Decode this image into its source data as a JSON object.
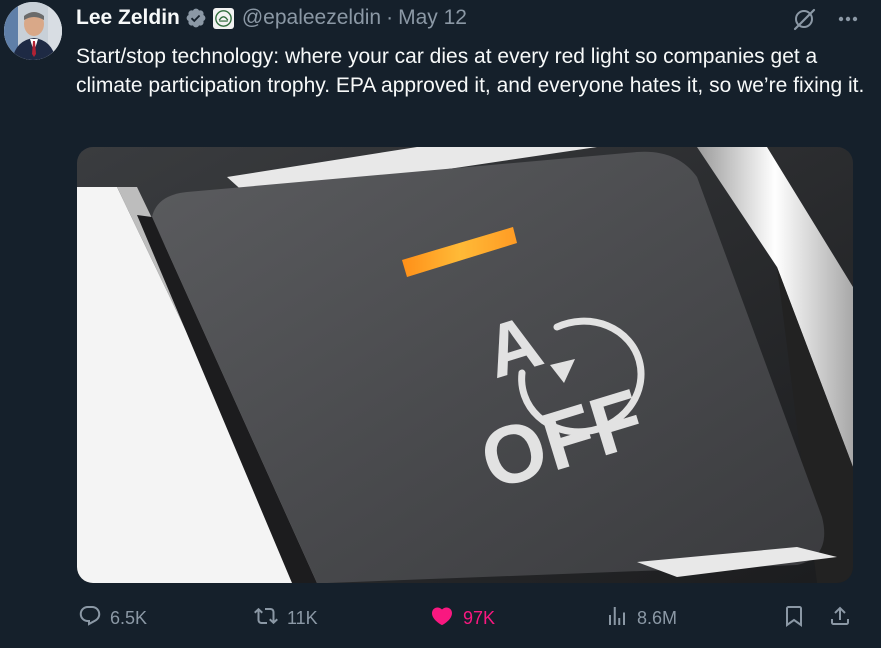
{
  "tweet": {
    "author_name": "Lee Zeldin",
    "handle": "@epaleezeldin",
    "separator": "·",
    "date": "May 12",
    "text": "Start/stop technology: where your car dies at every red light so companies get a climate participation trophy. EPA approved it, and everyone hates it, so we’re fixing it."
  },
  "media": {
    "button_letter": "A",
    "button_label": "OFF",
    "indicator_color": "#ff9a14"
  },
  "actions": {
    "replies": "6.5K",
    "reposts": "11K",
    "likes": "97K",
    "views": "8.6M"
  },
  "icons": {
    "verified": "verified-badge-icon",
    "affiliate": "epa-logo-icon",
    "grok": "grok-icon",
    "more": "more-icon",
    "reply": "reply-icon",
    "repost": "repost-icon",
    "like": "heart-icon",
    "views": "analytics-icon",
    "bookmark": "bookmark-icon",
    "share": "share-icon"
  },
  "colors": {
    "background": "#15202b",
    "text": "#f7f9f9",
    "secondary": "#8b98a5",
    "like": "#f91880",
    "verified": "#8b98a5"
  }
}
